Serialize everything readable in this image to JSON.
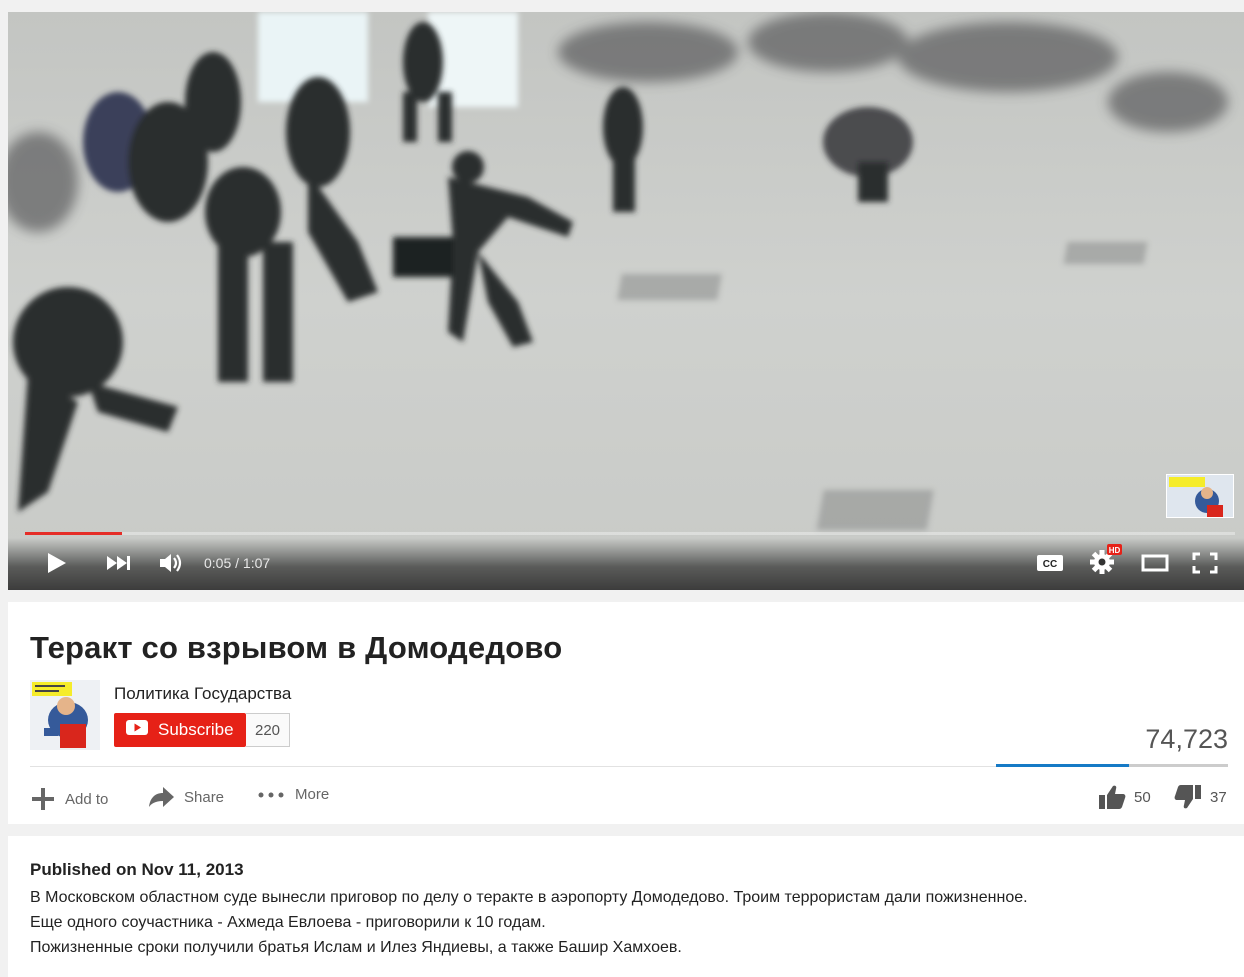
{
  "player": {
    "time_current": "0:05",
    "time_total": "1:07",
    "time_display": "0:05 / 1:07",
    "progress_fraction": 0.08,
    "cc_label": "CC",
    "hd_badge": "HD",
    "accent_color": "#e52d27",
    "icons": [
      "play-icon",
      "next-icon",
      "volume-icon",
      "cc-icon",
      "settings-icon",
      "theater-icon",
      "fullscreen-icon"
    ]
  },
  "video": {
    "title": "Теракт со взрывом в Домодедово",
    "channel_name": "Политика Государства",
    "subscribe_label": "Subscribe",
    "subscriber_count": "220",
    "view_count": "74,723",
    "like_ratio": 0.575
  },
  "actions": {
    "add_to": "Add to",
    "share": "Share",
    "more": "More",
    "likes": "50",
    "dislikes": "37"
  },
  "description": {
    "published": "Published on Nov 11, 2013",
    "lines": [
      "В Московском областном суде вынесли приговор по делу о теракте в аэропорту Домодедово. Троим террористам дали пожизненное.",
      "Еще одного соучастника - Ахмеда Евлоева - приговорили к 10 годам.",
      "Пожизненные сроки получили братья Ислам и Илез Яндиевы, а также Башир Хамхоев."
    ]
  },
  "colors": {
    "subscribe_red": "#e62117",
    "like_bar_blue": "#167ac6",
    "page_bg": "#f1f1f1"
  }
}
